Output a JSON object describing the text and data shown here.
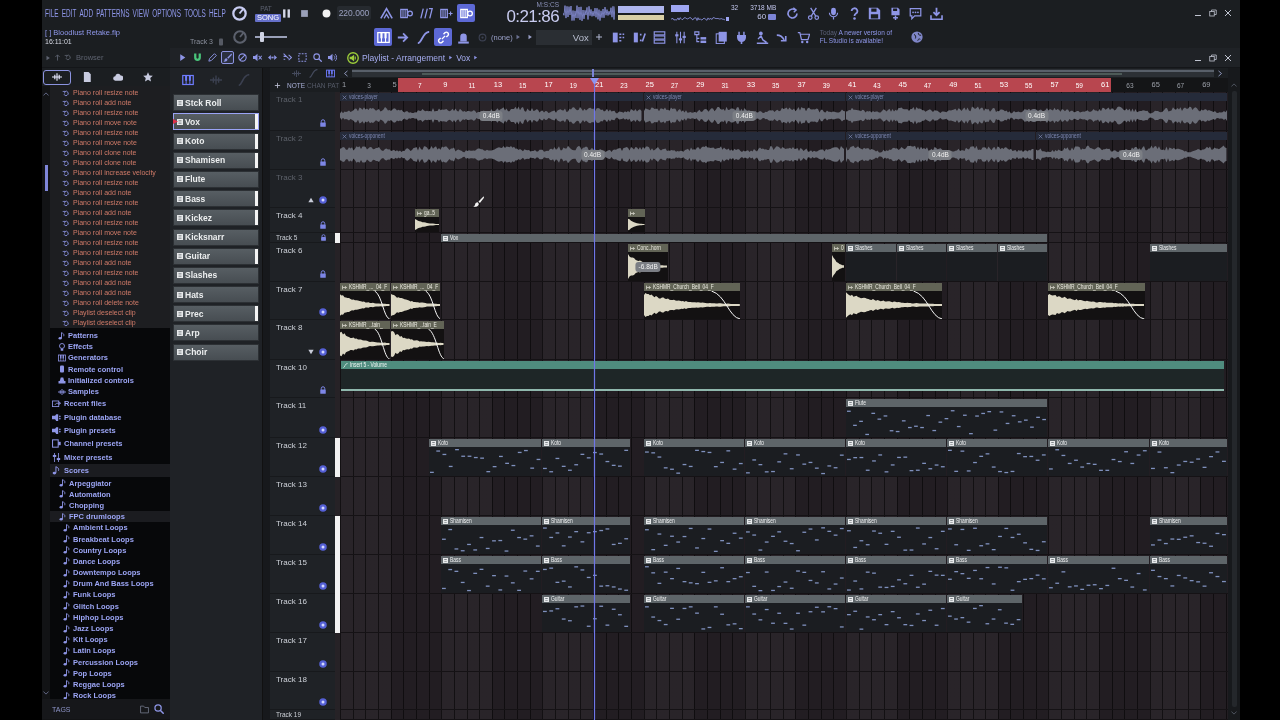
{
  "menu": [
    "FILE",
    "EDIT",
    "ADD",
    "PATTERNS",
    "VIEW",
    "OPTIONS",
    "TOOLS",
    "HELP"
  ],
  "transport": {
    "modes": [
      {
        "label": "PAT",
        "selected": false
      },
      {
        "label": "SONG",
        "selected": true
      }
    ],
    "playing": true,
    "tempo": "220.000",
    "time": "0:21:86",
    "time_unit": "M:S:CS"
  },
  "top_toggles": [
    {
      "kind": "wait",
      "on": false
    },
    {
      "kind": "blend",
      "on": false
    },
    {
      "kind": "countdown",
      "on": false
    },
    {
      "kind": "step",
      "on": false
    },
    {
      "kind": "loop",
      "on": true
    }
  ],
  "monitor": {
    "readout_1": "32",
    "memory": "3718 MB",
    "readout_2": "60"
  },
  "project": {
    "file": "[ ] Bloodlust Retake.flp",
    "clock": "16:11:01",
    "hint": "Track 3"
  },
  "pitch": {
    "level": 0.15
  },
  "tool_toggles": [
    {
      "kind": "keys",
      "on": true
    },
    {
      "kind": "arrow",
      "on": false
    },
    {
      "kind": "curve",
      "on": false
    },
    {
      "kind": "link",
      "on": true
    },
    {
      "kind": "bell",
      "on": false
    }
  ],
  "selector": "(none)",
  "pattern_field": "Vox",
  "news": {
    "date": "Today",
    "message": "A newer version of FL Studio is available!"
  },
  "browser": {
    "title": "Browser",
    "tabs": [
      {
        "kind": "all",
        "selected": true
      },
      {
        "kind": "files",
        "selected": false
      },
      {
        "kind": "cloud",
        "selected": false
      },
      {
        "kind": "favorites",
        "selected": false
      }
    ],
    "history": [
      "Piano roll resize note",
      "Piano roll add note",
      "Piano roll resize note",
      "Piano roll move note",
      "Piano roll resize note",
      "Piano roll move note",
      "Piano roll clone note",
      "Piano roll clone note",
      "Piano roll increase velocity",
      "Piano roll resize note",
      "Piano roll add note",
      "Piano roll resize note",
      "Piano roll add note",
      "Piano roll resize note",
      "Piano roll move note",
      "Piano roll resize note",
      "Piano roll resize note",
      "Piano roll add note",
      "Piano roll resize note",
      "Piano roll add note",
      "Piano roll add note",
      "Piano roll delete note",
      "Playlist deselect clip",
      "Playlist deselect clip"
    ],
    "project_items": [
      {
        "kind": "patterns",
        "label": "Patterns"
      },
      {
        "kind": "effects",
        "label": "Effects"
      },
      {
        "kind": "generators",
        "label": "Generators"
      },
      {
        "kind": "remote",
        "label": "Remote control"
      },
      {
        "kind": "initialized",
        "label": "Initialized controls"
      },
      {
        "kind": "samples",
        "label": "Samples"
      }
    ],
    "tree": [
      {
        "kind": "recent",
        "label": "Recent files",
        "expanded": false
      },
      {
        "kind": "plugins",
        "label": "Plugin database",
        "expanded": false
      },
      {
        "kind": "plugins",
        "label": "Plugin presets",
        "expanded": false
      },
      {
        "kind": "channels",
        "label": "Channel presets",
        "expanded": false
      },
      {
        "kind": "mixer",
        "label": "Mixer presets",
        "expanded": false
      },
      {
        "kind": "folder",
        "label": "Scores",
        "expanded": true,
        "children": [
          {
            "kind": "folder",
            "label": "Arpeggiator",
            "expanded": false
          },
          {
            "kind": "folder",
            "label": "Automation",
            "expanded": false
          },
          {
            "kind": "folder",
            "label": "Chopping",
            "expanded": false
          },
          {
            "kind": "folder",
            "label": "FPC drumloops",
            "expanded": true,
            "children": [
              {
                "kind": "folder",
                "label": "Ambient Loops",
                "expanded": false
              },
              {
                "kind": "folder",
                "label": "Breakbeat Loops",
                "expanded": false
              },
              {
                "kind": "folder",
                "label": "Country Loops",
                "expanded": false
              },
              {
                "kind": "folder",
                "label": "Dance Loops",
                "expanded": false
              },
              {
                "kind": "folder",
                "label": "Downtempo Loops",
                "expanded": false
              },
              {
                "kind": "folder",
                "label": "Drum And Bass Loops",
                "expanded": false
              },
              {
                "kind": "folder",
                "label": "Funk Loops",
                "expanded": false
              },
              {
                "kind": "folder",
                "label": "Glitch Loops",
                "expanded": false
              },
              {
                "kind": "folder",
                "label": "Hiphop Loops",
                "expanded": false
              },
              {
                "kind": "folder",
                "label": "Jazz Loops",
                "expanded": false
              },
              {
                "kind": "folder",
                "label": "Kit Loops",
                "expanded": false
              },
              {
                "kind": "folder",
                "label": "Latin Loops",
                "expanded": false
              },
              {
                "kind": "folder",
                "label": "Percussion Loops",
                "expanded": false
              },
              {
                "kind": "folder",
                "label": "Pop Loops",
                "expanded": false
              },
              {
                "kind": "folder",
                "label": "Reggae Loops",
                "expanded": false
              },
              {
                "kind": "folder",
                "label": "Rock Loops",
                "expanded": false
              }
            ]
          }
        ]
      }
    ],
    "footer": "TAGS"
  },
  "patterns": {
    "tabs": [
      {
        "kind": "patterns",
        "selected": true
      },
      {
        "kind": "audio",
        "selected": false
      },
      {
        "kind": "automation",
        "selected": false
      }
    ],
    "items": [
      {
        "label": "Stck Roll",
        "selected": false,
        "in_use": false
      },
      {
        "label": "Vox",
        "selected": true,
        "in_use": true
      },
      {
        "label": "Koto",
        "selected": false,
        "in_use": true
      },
      {
        "label": "Shamisen",
        "selected": false,
        "in_use": true
      },
      {
        "label": "Flute",
        "selected": false,
        "in_use": false
      },
      {
        "label": "Bass",
        "selected": false,
        "in_use": true
      },
      {
        "label": "Kickez",
        "selected": false,
        "in_use": true
      },
      {
        "label": "Kicksnarr",
        "selected": false,
        "in_use": false
      },
      {
        "label": "Guitar",
        "selected": false,
        "in_use": true
      },
      {
        "label": "Slashes",
        "selected": false,
        "in_use": false
      },
      {
        "label": "Hats",
        "selected": false,
        "in_use": false
      },
      {
        "label": "Prec",
        "selected": false,
        "in_use": true
      },
      {
        "label": "Arp",
        "selected": false,
        "in_use": false
      },
      {
        "label": "Choir",
        "selected": false,
        "in_use": false
      }
    ]
  },
  "playlist": {
    "title": "Playlist - Arrangement",
    "crumb": "Vox",
    "tools": [
      {
        "kind": "menu",
        "selected": false
      },
      {
        "kind": "snap",
        "selected": false
      },
      {
        "kind": "draw",
        "selected": false
      },
      {
        "kind": "paint",
        "selected": true
      },
      {
        "kind": "delete",
        "selected": false
      },
      {
        "kind": "mute",
        "selected": false
      },
      {
        "kind": "slip",
        "selected": false
      },
      {
        "kind": "slice",
        "selected": false
      },
      {
        "kind": "select",
        "selected": false
      },
      {
        "kind": "zoom",
        "selected": false
      },
      {
        "kind": "playback",
        "selected": false
      }
    ],
    "clip_types": [
      {
        "kind": "audio",
        "selected": false
      },
      {
        "kind": "automation",
        "selected": false
      },
      {
        "kind": "patterns",
        "selected": true
      }
    ],
    "filters": [
      {
        "label": "NOTE",
        "selected": true
      },
      {
        "label": "CHAN",
        "selected": false
      },
      {
        "label": "PAT",
        "selected": false
      }
    ],
    "ruler": [
      "1",
      "3",
      "5",
      "7",
      "9",
      "11",
      "13",
      "15",
      "17",
      "19",
      "21",
      "23",
      "25",
      "27",
      "29",
      "31",
      "33",
      "35",
      "37",
      "39",
      "41",
      "43",
      "45",
      "47",
      "49",
      "51",
      "53",
      "55",
      "57",
      "59",
      "61",
      "63",
      "65",
      "67",
      "69"
    ],
    "tracks": [
      {
        "name": "Track 1",
        "enabled": false,
        "locked": true,
        "active": false,
        "clips": [
          {
            "kind": "audio",
            "label": "voices-player",
            "badge": "0.4dB"
          },
          {
            "kind": "audio",
            "label": "voices-player",
            "badge": "0.4dB"
          },
          {
            "kind": "audio",
            "label": "voices-player",
            "badge": "0.4dB"
          }
        ]
      },
      {
        "name": "Track 2",
        "enabled": false,
        "locked": true,
        "active": false,
        "clips": [
          {
            "kind": "audio",
            "label": "voices-opponent",
            "badge": "0.4dB"
          },
          {
            "kind": "audio",
            "label": "voices-opponent",
            "badge": "0.4dB"
          },
          {
            "kind": "audio",
            "label": "voices-opponent",
            "badge": "0.4dB"
          }
        ]
      },
      {
        "name": "Track 3",
        "enabled": false,
        "locked": false,
        "active": false
      },
      {
        "name": "Track 4",
        "enabled": true,
        "locked": true,
        "active": false,
        "clips": [
          {
            "kind": "sample",
            "label": "ga..5"
          },
          {
            "kind": "sample"
          }
        ]
      },
      {
        "name": "Track 5",
        "enabled": true,
        "locked": true,
        "active": true,
        "clips": [
          {
            "kind": "pattern",
            "label": "Vox"
          }
        ]
      },
      {
        "name": "Track 6",
        "enabled": true,
        "locked": true,
        "active": false,
        "clips": [
          {
            "kind": "sample",
            "label": "Conc..horn",
            "badge": "-6.8dB"
          },
          {
            "kind": "sample",
            "label": "0"
          },
          {
            "kind": "pattern",
            "label": "Slashes"
          },
          {
            "kind": "pattern",
            "label": "Slashes"
          },
          {
            "kind": "pattern",
            "label": "Slashes"
          },
          {
            "kind": "pattern",
            "label": "Slashes"
          },
          {
            "kind": "pattern",
            "label": "Slashes"
          }
        ]
      },
      {
        "name": "Track 7",
        "enabled": true,
        "locked": false,
        "active": false,
        "clips": [
          {
            "kind": "sample",
            "label": "KSHMR_..._04_F"
          },
          {
            "kind": "sample",
            "label": "KSHMR_..._04_F"
          },
          {
            "kind": "sample",
            "label": "KSHMR_Church_Bell_04_F"
          },
          {
            "kind": "sample",
            "label": "KSHMR_Church_Bell_04_F"
          },
          {
            "kind": "sample",
            "label": "KSHMR_Church_Bell_04_F"
          }
        ]
      },
      {
        "name": "Track 8",
        "enabled": true,
        "locked": false,
        "active": false,
        "clips": [
          {
            "kind": "sample",
            "label": "KSHMR_..tain_"
          },
          {
            "kind": "sample",
            "label": "KSHMR_..tain_E"
          }
        ]
      },
      {
        "name": "Track 10",
        "enabled": true,
        "locked": true,
        "active": false,
        "clips": [
          {
            "kind": "automation",
            "label": "Insert 5 - Volume"
          }
        ]
      },
      {
        "name": "Track 11",
        "enabled": true,
        "locked": false,
        "active": false,
        "clips": [
          {
            "kind": "pattern",
            "label": "Flute"
          }
        ]
      },
      {
        "name": "Track 12",
        "enabled": true,
        "locked": false,
        "active": true,
        "clips": [
          {
            "kind": "pattern",
            "label": "Koto"
          },
          {
            "kind": "pattern",
            "label": "Koto"
          },
          {
            "kind": "pattern",
            "label": "Koto"
          },
          {
            "kind": "pattern",
            "label": "Koto"
          },
          {
            "kind": "pattern",
            "label": "Koto"
          },
          {
            "kind": "pattern",
            "label": "Koto"
          },
          {
            "kind": "pattern",
            "label": "Koto"
          },
          {
            "kind": "pattern",
            "label": "Koto"
          }
        ]
      },
      {
        "name": "Track 13",
        "enabled": true,
        "locked": false,
        "active": false
      },
      {
        "name": "Track 14",
        "enabled": true,
        "locked": false,
        "active": true,
        "clips": [
          {
            "kind": "pattern",
            "label": "Shamisen"
          },
          {
            "kind": "pattern",
            "label": "Shamisen"
          },
          {
            "kind": "pattern",
            "label": "Shamisen"
          },
          {
            "kind": "pattern",
            "label": "Shamisen"
          },
          {
            "kind": "pattern",
            "label": "Shamisen"
          },
          {
            "kind": "pattern",
            "label": "Shamisen"
          },
          {
            "kind": "pattern",
            "label": "Shamisen"
          }
        ]
      },
      {
        "name": "Track 15",
        "enabled": true,
        "locked": false,
        "active": true,
        "clips": [
          {
            "kind": "pattern",
            "label": "Bass"
          },
          {
            "kind": "pattern",
            "label": "Bass"
          },
          {
            "kind": "pattern",
            "label": "Bass"
          },
          {
            "kind": "pattern",
            "label": "Bass"
          },
          {
            "kind": "pattern",
            "label": "Bass"
          },
          {
            "kind": "pattern",
            "label": "Bass"
          },
          {
            "kind": "pattern",
            "label": "Bass"
          },
          {
            "kind": "pattern",
            "label": "Bass"
          }
        ]
      },
      {
        "name": "Track 16",
        "enabled": true,
        "locked": false,
        "active": true,
        "clips": [
          {
            "kind": "pattern",
            "label": "Guitar"
          },
          {
            "kind": "pattern",
            "label": "Guitar"
          },
          {
            "kind": "pattern",
            "label": "Guitar"
          },
          {
            "kind": "pattern",
            "label": "Guitar"
          },
          {
            "kind": "pattern",
            "label": "Guitar"
          }
        ]
      },
      {
        "name": "Track 17",
        "enabled": true,
        "locked": false,
        "active": false
      },
      {
        "name": "Track 18",
        "enabled": true,
        "locked": false,
        "active": false
      },
      {
        "name": "Track 19",
        "enabled": true,
        "active": false
      }
    ]
  }
}
